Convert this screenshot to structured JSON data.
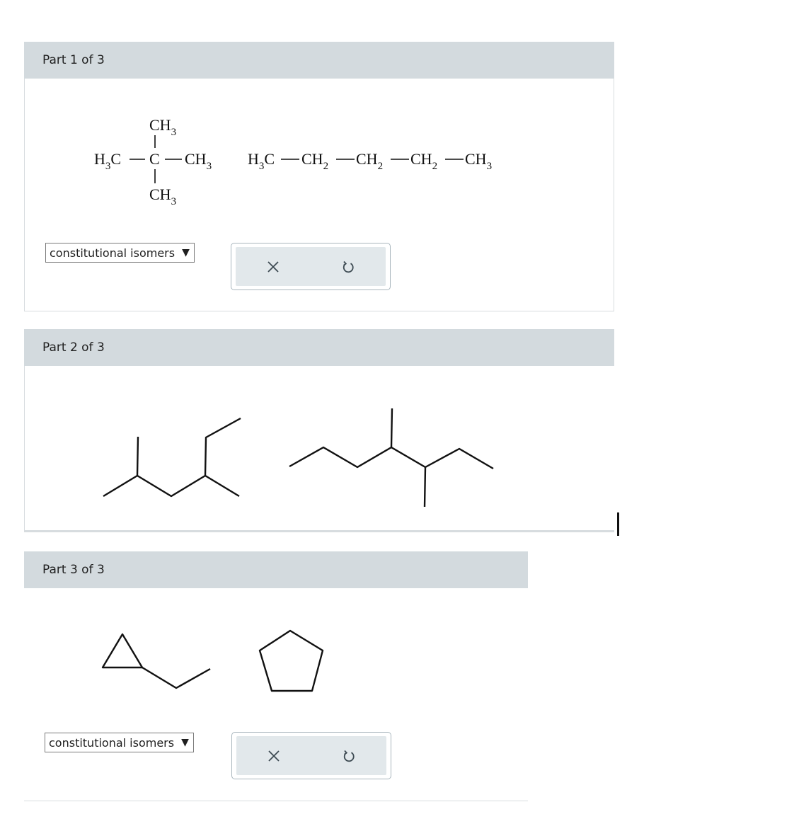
{
  "parts": [
    {
      "header": "Part 1 of 3",
      "molecule_a": {
        "top": "CH",
        "top_sub": "3",
        "left": "H",
        "left_sub": "3",
        "left_c": "C",
        "center": "C",
        "right": "CH",
        "right_sub": "3",
        "bottom": "CH",
        "bottom_sub": "3"
      },
      "molecule_b": {
        "g1": "H",
        "g1_sub": "3",
        "g1_c": "C",
        "g2": "CH",
        "g2_sub": "2",
        "g3": "CH",
        "g3_sub": "2",
        "g4": "CH",
        "g4_sub": "2",
        "g5": "CH",
        "g5_sub": "3"
      },
      "select_value": "constitutional isomers"
    },
    {
      "header": "Part 2 of 3"
    },
    {
      "header": "Part 3 of 3",
      "select_value": "constitutional isomers"
    }
  ],
  "icons": {
    "dropdown": "triangle-down-icon",
    "clear": "close-icon",
    "reset": "undo-icon"
  }
}
